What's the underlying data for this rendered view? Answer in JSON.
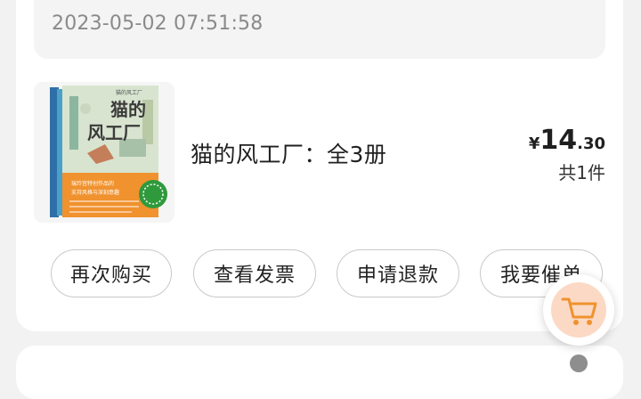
{
  "order": {
    "timestamp": "2023-05-02 07:51:58"
  },
  "product": {
    "title": "猫的风工厂：全3册",
    "cover_title": "猫的\n风工厂",
    "cover_series": "猫的风工厂",
    "cover_tagline_1": "瑞玲宫特创作品的",
    "cover_tagline_2": "支持风格与深刻意趣",
    "currency": "¥",
    "price_integer": "14",
    "price_decimal": ".30",
    "quantity_text": "共1件"
  },
  "actions": {
    "buy_again": "再次购买",
    "view_invoice": "查看发票",
    "request_refund": "申请退款",
    "urge_shipping": "我要催单"
  },
  "colors": {
    "accent_orange": "#f0922e",
    "fab_bg": "#fbd9c4"
  },
  "icons": {
    "fab": "shopping-cart-icon"
  }
}
